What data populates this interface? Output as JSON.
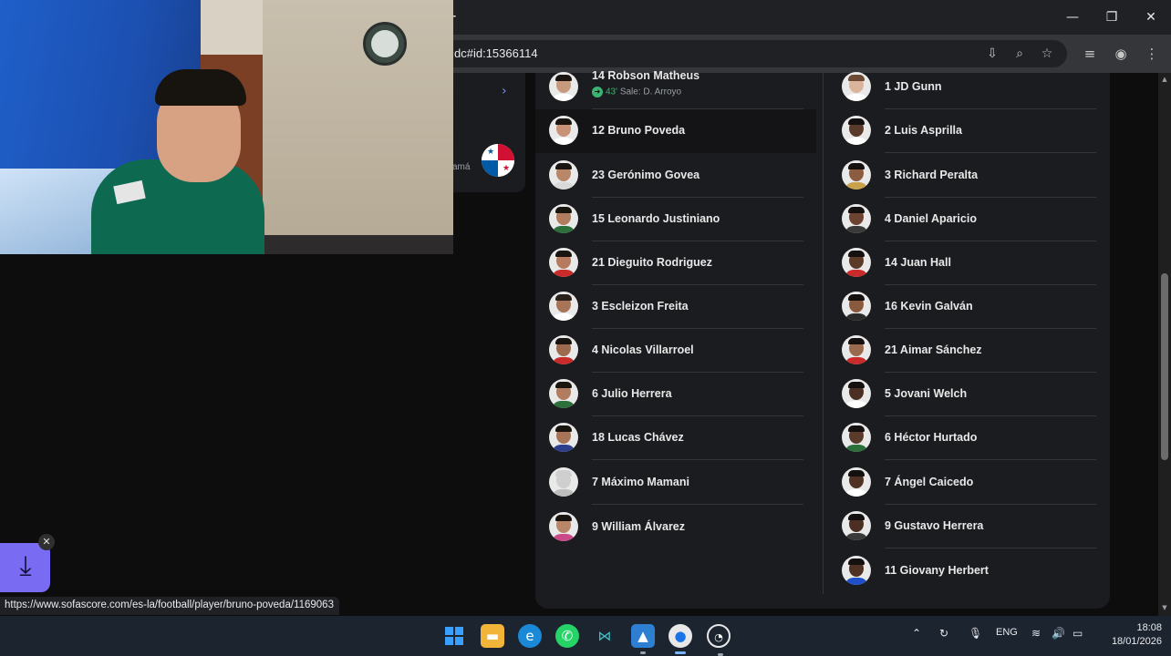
{
  "browser": {
    "url": "dc#id:15366114",
    "status_link": "https://www.sofascore.com/es-la/football/player/bruno-poveda/1169063"
  },
  "side_panel": {
    "team_label": "amá"
  },
  "lineups": {
    "left": [
      {
        "label": "14 Robson Matheus",
        "sub_minute": "43'",
        "sub_text": "Sale:  D. Arroyo",
        "skin": "#c79a7e",
        "hair": "#1a1410",
        "shirt": "#ffffff"
      },
      {
        "label": "12 Bruno Poveda",
        "active": true,
        "skin": "#c89276",
        "hair": "#1b1510",
        "shirt": "#ffffff"
      },
      {
        "label": "23 Gerónimo Govea",
        "skin": "#b98667",
        "hair": "#1a1410",
        "shirt": "#d9d9d9"
      },
      {
        "label": "15 Leonardo Justiniano",
        "skin": "#b17c5f",
        "hair": "#1b1510",
        "shirt": "#2b6f3a"
      },
      {
        "label": "21 Dieguito Rodriguez",
        "skin": "#b67b5e",
        "hair": "#1a1410",
        "shirt": "#c92b2b"
      },
      {
        "label": "3 Escleizon Freita",
        "skin": "#a87457",
        "hair": "#2a211b",
        "shirt": "#ffffff"
      },
      {
        "label": "4 Nicolas Villarroel",
        "skin": "#9e6a4f",
        "hair": "#1a1410",
        "shirt": "#c92b2b"
      },
      {
        "label": "6 Julio Herrera",
        "skin": "#b17c5f",
        "hair": "#1b1510",
        "shirt": "#2b6f3a"
      },
      {
        "label": "18 Lucas Chávez",
        "skin": "#a87457",
        "hair": "#1b1510",
        "shirt": "#2c3e8c"
      },
      {
        "label": "7 Máximo Mamani",
        "placeholder": true,
        "skin": "#cfcfcf",
        "hair": "#cfcfcf",
        "shirt": "#bdbdbd"
      },
      {
        "label": "9 William Álvarez",
        "skin": "#b98667",
        "hair": "#1a1410",
        "shirt": "#c94a8a"
      }
    ],
    "right": [
      {
        "label": "1 JD Gunn",
        "skin": "#d9b39a",
        "hair": "#6b4a36",
        "shirt": "#ffffff"
      },
      {
        "label": "2 Luis Asprilla",
        "skin": "#5a3a2a",
        "hair": "#141010",
        "shirt": "#ffffff"
      },
      {
        "label": "3 Richard Peralta",
        "skin": "#8c5c40",
        "hair": "#141010",
        "shirt": "#c9a14a"
      },
      {
        "label": "4 Daniel Aparicio",
        "skin": "#6b4330",
        "hair": "#141010",
        "shirt": "#3a3a3a"
      },
      {
        "label": "14 Juan Hall",
        "skin": "#5c3a28",
        "hair": "#141010",
        "shirt": "#c92b2b"
      },
      {
        "label": "16 Kevin Galván",
        "skin": "#8a5a3e",
        "hair": "#141010",
        "shirt": "#2a2a2a"
      },
      {
        "label": "21 Aimar Sánchez",
        "skin": "#9a6a4e",
        "hair": "#141010",
        "shirt": "#c92b2b"
      },
      {
        "label": "5 Jovani Welch",
        "skin": "#4b2f22",
        "hair": "#141010",
        "shirt": "#ffffff"
      },
      {
        "label": "6 Héctor Hurtado",
        "skin": "#5a3a2a",
        "hair": "#141010",
        "shirt": "#2b6f3a"
      },
      {
        "label": "7 Ángel Caicedo",
        "skin": "#4f3224",
        "hair": "#141010",
        "shirt": "#ffffff"
      },
      {
        "label": "9 Gustavo Herrera",
        "skin": "#4b2f22",
        "hair": "#141010",
        "shirt": "#3a3a3a"
      },
      {
        "label": "11 Giovany Herbert",
        "skin": "#4f3224",
        "hair": "#141010",
        "shirt": "#1f4fc9"
      }
    ]
  },
  "taskbar": {
    "language": "ENG",
    "time": "18:08",
    "date": "18/01/2026"
  },
  "colors": {
    "accent": "#7a6cf2",
    "sub_green": "#3cb371",
    "panel": "#1b1c1f"
  }
}
